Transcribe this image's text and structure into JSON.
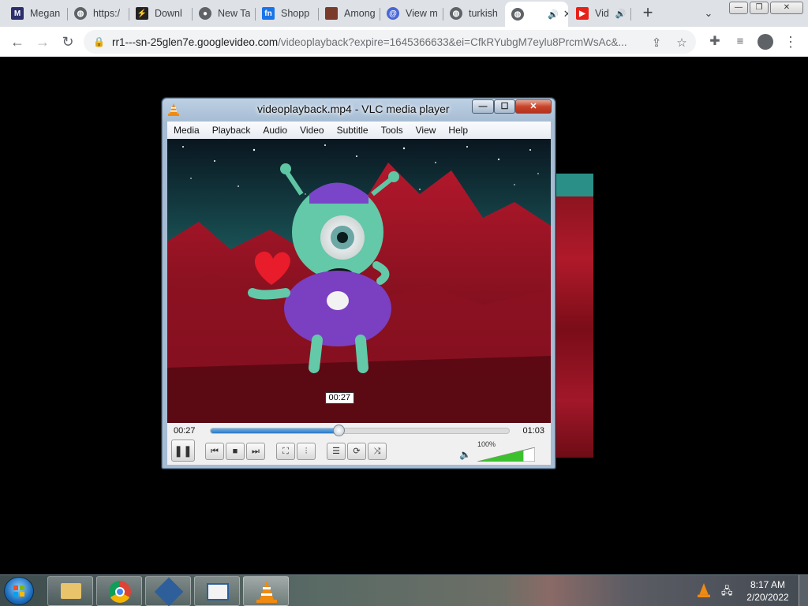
{
  "browser": {
    "tabs": [
      {
        "title": "Megan",
        "favicon": "site-icon"
      },
      {
        "title": "https:/",
        "favicon": "globe-icon"
      },
      {
        "title": "Downl",
        "favicon": "download-site-icon"
      },
      {
        "title": "New Ta",
        "favicon": "chrome-icon"
      },
      {
        "title": "Shopp",
        "favicon": "fn-icon"
      },
      {
        "title": "Among",
        "favicon": "image-icon"
      },
      {
        "title": "View m",
        "favicon": "at-icon"
      },
      {
        "title": "turkish",
        "favicon": "globe-icon"
      },
      {
        "title": "",
        "favicon": "globe-icon",
        "active": true
      },
      {
        "title": "Vid",
        "favicon": "youtube-icon"
      }
    ],
    "address": {
      "domain": "rr1---sn-25glen7e.googlevideo.com",
      "path": "/videoplayback?expire=1645366633&ei=CfkRYubgM7eylu8PrcmWsAc&..."
    }
  },
  "vlc": {
    "title": "videoplayback.mp4 - VLC media player",
    "menu": [
      "Media",
      "Playback",
      "Audio",
      "Video",
      "Subtitle",
      "Tools",
      "View",
      "Help"
    ],
    "time_current": "00:27",
    "time_total": "01:03",
    "seek_tooltip": "00:27",
    "progress_fraction": 0.43,
    "volume_label": "100%",
    "volume_fraction": 0.8,
    "accent": "#2c78c3"
  },
  "taskbar": {
    "apps": [
      "windows-explorer",
      "chrome",
      "virtualbox",
      "app-window",
      "vlc"
    ],
    "clock_time": "8:17 AM",
    "clock_date": "2/20/2022"
  }
}
